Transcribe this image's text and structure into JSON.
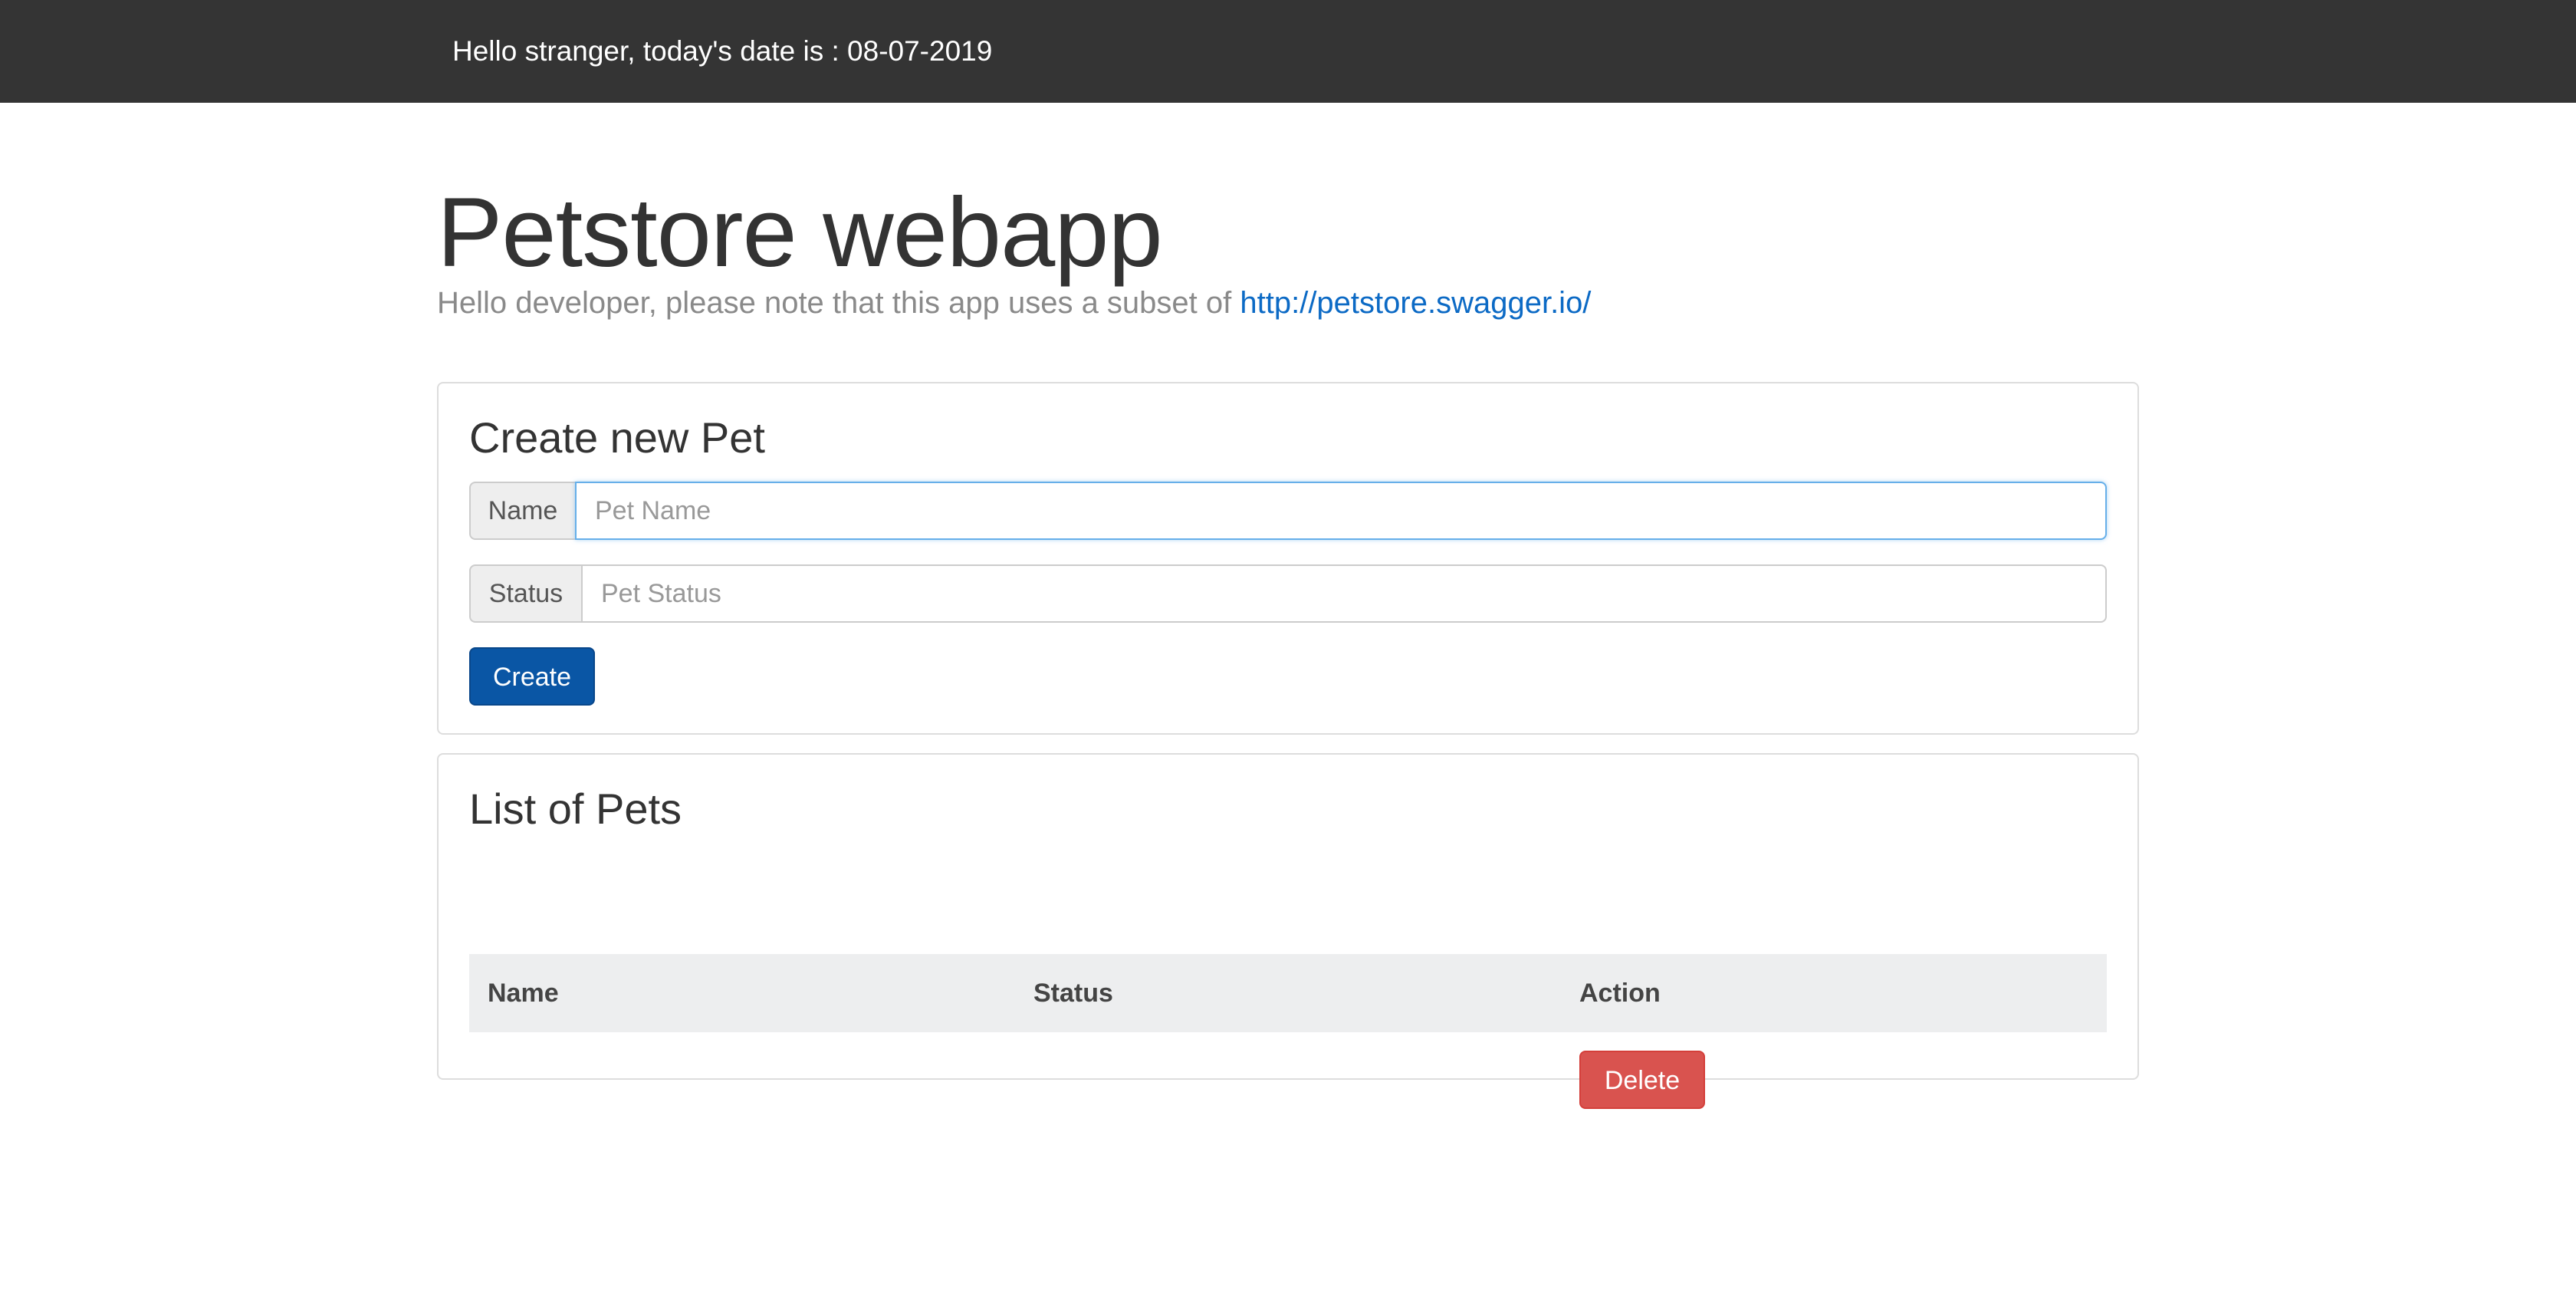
{
  "header": {
    "greeting": "Hello stranger, today's date is : 08-07-2019"
  },
  "page": {
    "title": "Petstore webapp",
    "subtitle_prefix": "Hello developer, please note that this app uses a subset of ",
    "subtitle_link": "http://petstore.swagger.io/"
  },
  "create_panel": {
    "title": "Create new Pet",
    "name_label": "Name",
    "name_placeholder": "Pet Name",
    "name_value": "",
    "status_label": "Status",
    "status_placeholder": "Pet Status",
    "status_value": "",
    "create_button": "Create"
  },
  "list_panel": {
    "title": "List of Pets",
    "columns": [
      "Name",
      "Status",
      "Action"
    ],
    "rows": [
      {
        "name": "",
        "status": "",
        "action": "Delete"
      }
    ]
  },
  "colors": {
    "topbar": "#343434",
    "primary": "#0a56a5",
    "danger": "#d9534f",
    "link": "#0c6ac5"
  }
}
